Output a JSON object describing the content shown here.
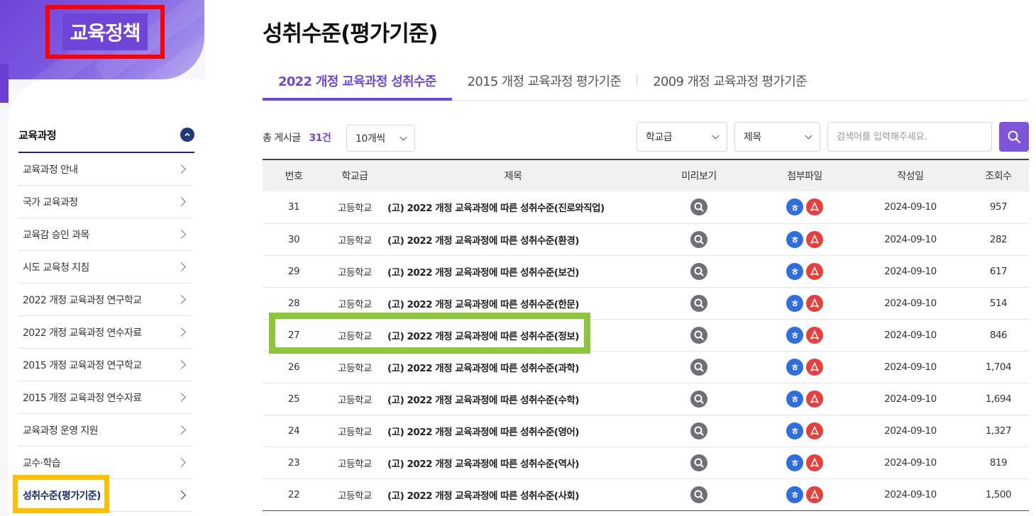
{
  "sidebar": {
    "title": "교육정책",
    "section": "교육과정",
    "items": [
      {
        "label": "교육과정 안내"
      },
      {
        "label": "국가 교육과정"
      },
      {
        "label": "교육감 승인 과목"
      },
      {
        "label": "시도 교육청 지침"
      },
      {
        "label": "2022 개정 교육과정 연구학교"
      },
      {
        "label": "2022 개정 교육과정 연수자료"
      },
      {
        "label": "2015 개정 교육과정 연구학교"
      },
      {
        "label": "2015 개정 교육과정 연수자료"
      },
      {
        "label": "교육과정 운영 지원"
      },
      {
        "label": "교수·학습"
      }
    ],
    "active_item": "성취수준(평가기준)"
  },
  "main": {
    "title": "성취수준(평가기준)",
    "tabs": [
      {
        "label": "2022 개정 교육과정 성취수준"
      },
      {
        "label": "2015 개정 교육과정 평가기준"
      },
      {
        "label": "2009 개정 교육과정 평가기준"
      }
    ],
    "total_label": "총 게시글",
    "total_count": "31건",
    "page_size": "10개씩",
    "filter_level": "학교급",
    "filter_field": "제목",
    "search_placeholder": "검색어를 입력해주세요.",
    "columns": {
      "no": "번호",
      "level": "학교급",
      "title": "제목",
      "preview": "미리보기",
      "files": "첨부파일",
      "date": "작성일",
      "views": "조회수"
    },
    "rows": [
      {
        "no": "31",
        "level": "고등학교",
        "title": "(고) 2022 개정 교육과정에 따른 성취수준(진로와직업)",
        "date": "2024-09-10",
        "views": "957"
      },
      {
        "no": "30",
        "level": "고등학교",
        "title": "(고) 2022 개정 교육과정에 따른 성취수준(환경)",
        "date": "2024-09-10",
        "views": "282"
      },
      {
        "no": "29",
        "level": "고등학교",
        "title": "(고) 2022 개정 교육과정에 따른 성취수준(보건)",
        "date": "2024-09-10",
        "views": "617"
      },
      {
        "no": "28",
        "level": "고등학교",
        "title": "(고) 2022 개정 교육과정에 따른 성취수준(한문)",
        "date": "2024-09-10",
        "views": "514"
      },
      {
        "no": "27",
        "level": "고등학교",
        "title": "(고) 2022 개정 교육과정에 따른 성취수준(정보)",
        "date": "2024-09-10",
        "views": "846"
      },
      {
        "no": "26",
        "level": "고등학교",
        "title": "(고) 2022 개정 교육과정에 따른 성취수준(과학)",
        "date": "2024-09-10",
        "views": "1,704"
      },
      {
        "no": "25",
        "level": "고등학교",
        "title": "(고) 2022 개정 교육과정에 따른 성취수준(수학)",
        "date": "2024-09-10",
        "views": "1,694"
      },
      {
        "no": "24",
        "level": "고등학교",
        "title": "(고) 2022 개정 교육과정에 따른 성취수준(영어)",
        "date": "2024-09-10",
        "views": "1,327"
      },
      {
        "no": "23",
        "level": "고등학교",
        "title": "(고) 2022 개정 교육과정에 따른 성취수준(역사)",
        "date": "2024-09-10",
        "views": "819"
      },
      {
        "no": "22",
        "level": "고등학교",
        "title": "(고) 2022 개정 교육과정에 따른 성취수준(사회)",
        "date": "2024-09-10",
        "views": "1,500"
      }
    ],
    "hwp_glyph": "ㅎ"
  },
  "colors": {
    "accent": "#6f48d8",
    "title_outline": "#ff0000",
    "active_outline": "#ffc000",
    "row_outline": "#8cc63f",
    "hwp": "#2f6ee0",
    "pdf": "#e5403c"
  },
  "icons": [
    "search-icon",
    "chevron-right-icon",
    "chevron-up-icon",
    "chevron-down-icon",
    "preview-icon",
    "hwp-file-icon",
    "pdf-file-icon"
  ]
}
